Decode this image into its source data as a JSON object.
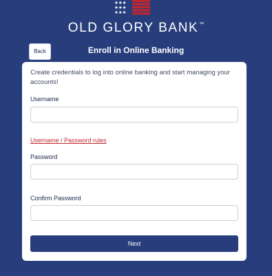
{
  "header": {
    "brand_name": "OLD GLORY BANK",
    "trademark": "™",
    "logo_icon": "stars-and-stripes-flag-icon",
    "colors": {
      "background": "#283e7c",
      "stripe_red": "#c0272d",
      "star_white": "#ffffff"
    }
  },
  "nav": {
    "back_label": "Back"
  },
  "page": {
    "title": "Enroll in Online Banking"
  },
  "form": {
    "intro": "Create credentials to log into online banking and start managing your accounts!",
    "username_label": "Username",
    "username_value": "",
    "rules_link": "Username / Password rules",
    "password_label": "Password",
    "password_value": "",
    "confirm_label": "Confirm Password",
    "confirm_value": "",
    "next_label": "Next"
  }
}
